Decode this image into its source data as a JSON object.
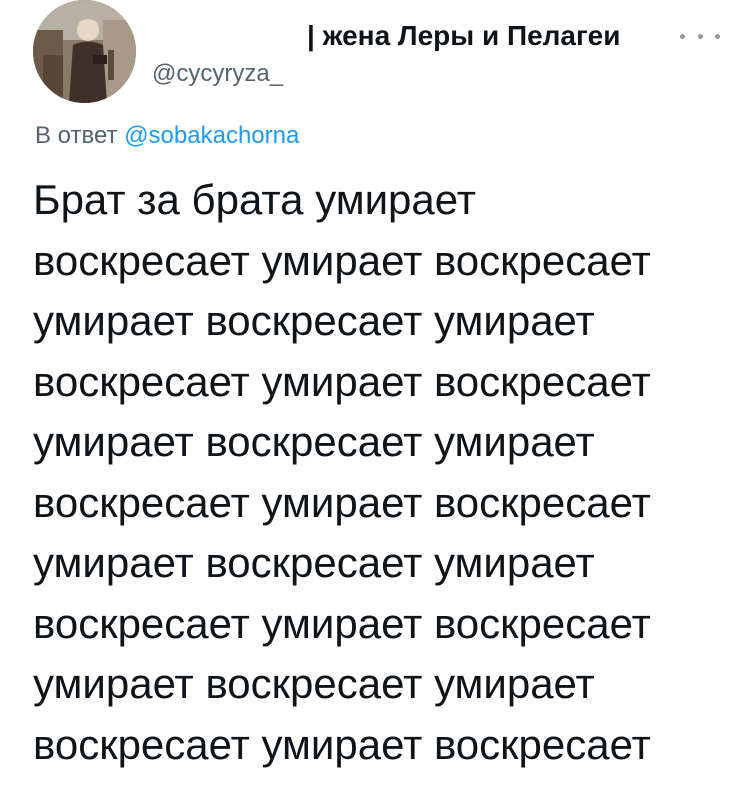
{
  "author": {
    "display_name": "| жена Леры и Пелагеи",
    "handle": "@cycyryza_",
    "avatar_icon": "profile-photo"
  },
  "more_icon": "more-options-icon",
  "reply": {
    "prefix": "В ответ",
    "mention": "@sobakachorna"
  },
  "tweet": {
    "lines": [
      "Брат за брата умирает",
      "воскресает умирает воскресает",
      "умирает воскресает умирает",
      "воскресает умирает воскресает",
      "умирает воскресает умирает",
      "воскресает умирает воскресает",
      "умирает воскресает умирает",
      "воскресает умирает воскресает",
      "умирает воскресает умирает",
      "воскресает умирает воскресает"
    ]
  },
  "colors": {
    "text": "#0f1419",
    "secondary": "#536471",
    "link": "#1d9bf0"
  }
}
